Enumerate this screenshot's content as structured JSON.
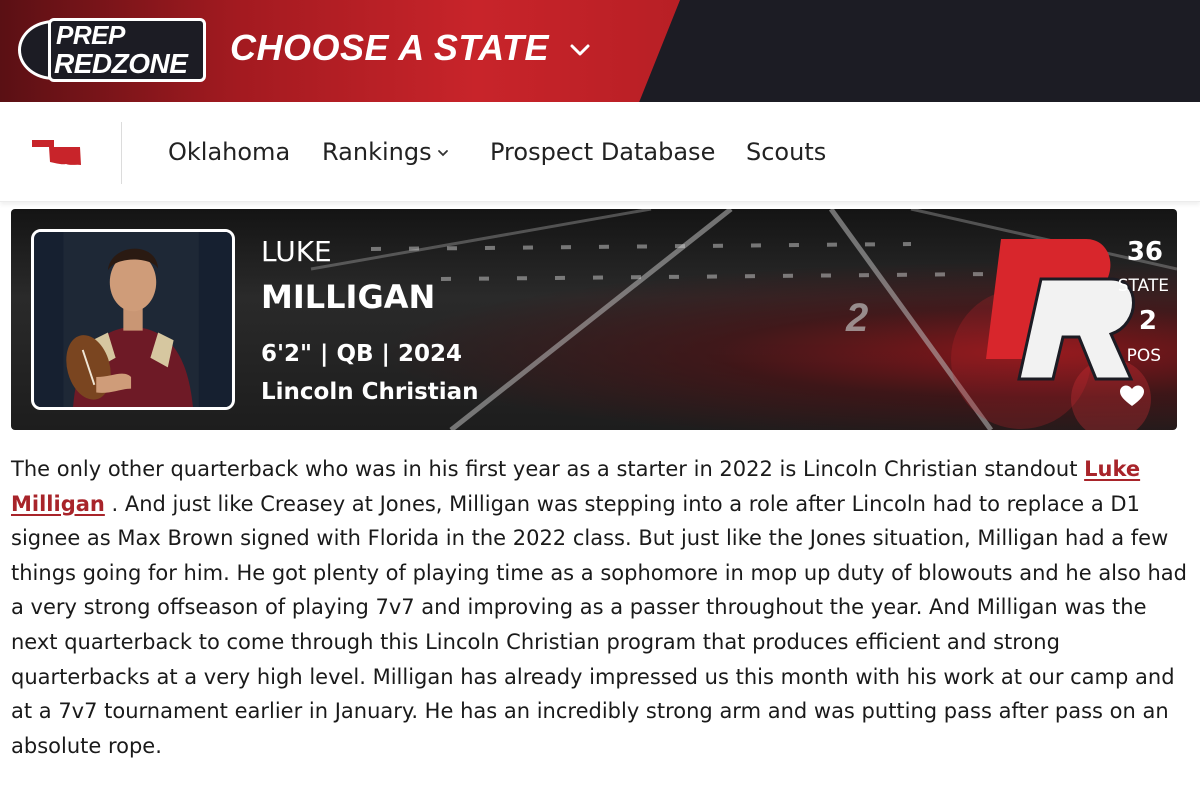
{
  "header": {
    "logo_line1": "PREP",
    "logo_line2": "REDZONE",
    "state_selector_label": "CHOOSE A STATE",
    "accent_color": "#c8242a",
    "dark_color": "#1c1c24"
  },
  "nav": {
    "state_icon": "oklahoma-state-icon",
    "items": [
      {
        "label": "Oklahoma"
      },
      {
        "label": "Rankings",
        "has_dropdown": true
      },
      {
        "label": "Prospect Database"
      },
      {
        "label": "Scouts"
      }
    ]
  },
  "player": {
    "first_name": "LUKE",
    "last_name": "MILLIGAN",
    "details": "6'2\" | QB | 2024",
    "school": "Lincoln Christian",
    "state_rank": "36",
    "state_rank_label": "STATE",
    "pos_rank": "2",
    "pos_rank_label": "POS",
    "favorite_icon": "heart-icon"
  },
  "article": {
    "intro": "The only other quarterback who was in his first year as a starter in 2022 is Lincoln Christian standout ",
    "player_link": "Luke Milligan",
    "body": " . And just like Creasey at Jones, Milligan was stepping into a role after Lincoln had to replace a D1 signee as Max Brown signed with Florida in the 2022 class. But just like the Jones situation, Milligan had a few things going for him. He got plenty of playing time as a sophomore in mop up duty of blowouts and he also had a very strong offseason of playing 7v7 and improving as a passer throughout the year. And Milligan was the next quarterback to come through this Lincoln Christian program that produces efficient and strong quarterbacks at a very high level. Milligan has already impressed us this month with his work at our camp and at a 7v7 tournament earlier in January. He has an incredibly strong arm and was putting pass after pass on an absolute rope."
  }
}
